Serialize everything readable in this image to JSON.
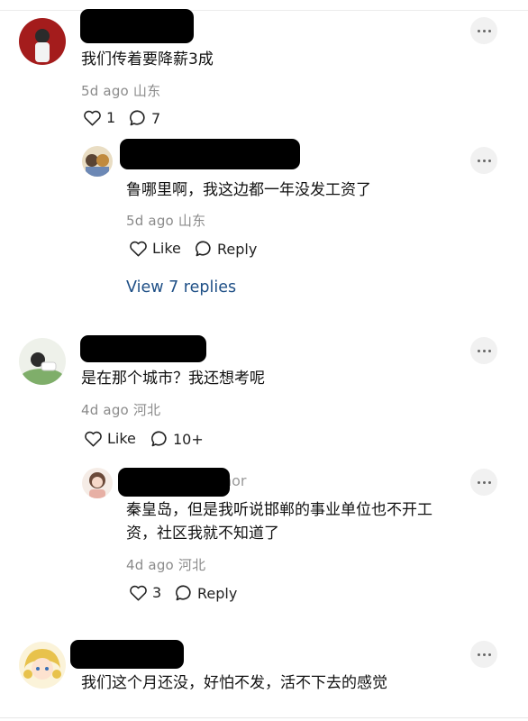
{
  "comments": [
    {
      "text": "我们传着要降薪3成",
      "time": "5d ago",
      "location": "山东",
      "likes": "1",
      "replies_count": "7",
      "reply": {
        "text": "鲁哪里啊，我这边都一年没发工资了",
        "time": "5d ago",
        "location": "山东",
        "like_label": "Like",
        "reply_label": "Reply",
        "view_replies": "View 7 replies"
      }
    },
    {
      "text": "是在那个城市？我还想考呢",
      "time": "4d ago",
      "location": "河北",
      "like_label": "Like",
      "replies_count": "10+",
      "reply": {
        "author_badge_partial": "hor",
        "text_line1": "秦皇岛，但是我听说邯郸的事业单位也不开工",
        "text_line2": "资，社区我就不知道了",
        "time": "4d ago",
        "location": "河北",
        "likes": "3",
        "reply_label": "Reply"
      }
    },
    {
      "text": "我们这个月还没，好怕不发，活不下去的感觉"
    }
  ]
}
